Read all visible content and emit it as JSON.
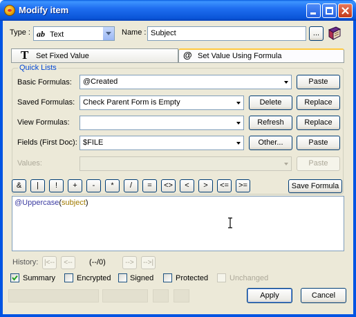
{
  "window": {
    "title": "Modify item"
  },
  "type_label": "Type :",
  "type_value": "Text",
  "type_icon": "ab-text-icon",
  "name_label": "Name :",
  "name_value": "Subject",
  "ellipsis_button": "...",
  "tabs": [
    {
      "label": "Set Fixed Value",
      "icon": "T"
    },
    {
      "label": "Set Value Using Formula",
      "icon": "@"
    }
  ],
  "quick_lists": {
    "title": "Quick Lists",
    "rows": [
      {
        "label": "Basic Formulas:",
        "value": "@Created",
        "buttons": [
          "Paste"
        ]
      },
      {
        "label": "Saved Formulas:",
        "value": "Check Parent Form is Empty",
        "buttons": [
          "Delete",
          "Replace"
        ]
      },
      {
        "label": "View Formulas:",
        "value": "",
        "buttons": [
          "Refresh",
          "Replace"
        ]
      },
      {
        "label": "Fields (First Doc):",
        "value": "$FILE",
        "buttons": [
          "Other...",
          "Paste"
        ]
      },
      {
        "label": "Values:",
        "value": "",
        "buttons": [
          "Paste"
        ]
      }
    ]
  },
  "operators": [
    "&",
    "|",
    "!",
    "+",
    "-",
    "*",
    "/",
    "=",
    "<>",
    "<",
    ">",
    "<=",
    ">="
  ],
  "save_formula": "Save Formula",
  "formula": {
    "function": "@Uppercase",
    "open": "(",
    "argument": "subject",
    "close": ")"
  },
  "history": {
    "label": "History:",
    "first": "|<--",
    "prev": "<--",
    "position": "(--/0)",
    "next": "-->",
    "last": "-->|"
  },
  "checkboxes": [
    {
      "label": "Summary",
      "checked": true,
      "enabled": true
    },
    {
      "label": "Encrypted",
      "checked": false,
      "enabled": true
    },
    {
      "label": "Signed",
      "checked": false,
      "enabled": true
    },
    {
      "label": "Protected",
      "checked": false,
      "enabled": true
    },
    {
      "label": "Unchanged",
      "checked": false,
      "enabled": false
    }
  ],
  "apply": "Apply",
  "cancel": "Cancel",
  "colors": {
    "title_bar": "#0a55d8",
    "dialog_bg": "#ece9d8",
    "group_title": "#0046d5",
    "formula_function": "#3a3aa0",
    "formula_argument": "#a07a00"
  }
}
